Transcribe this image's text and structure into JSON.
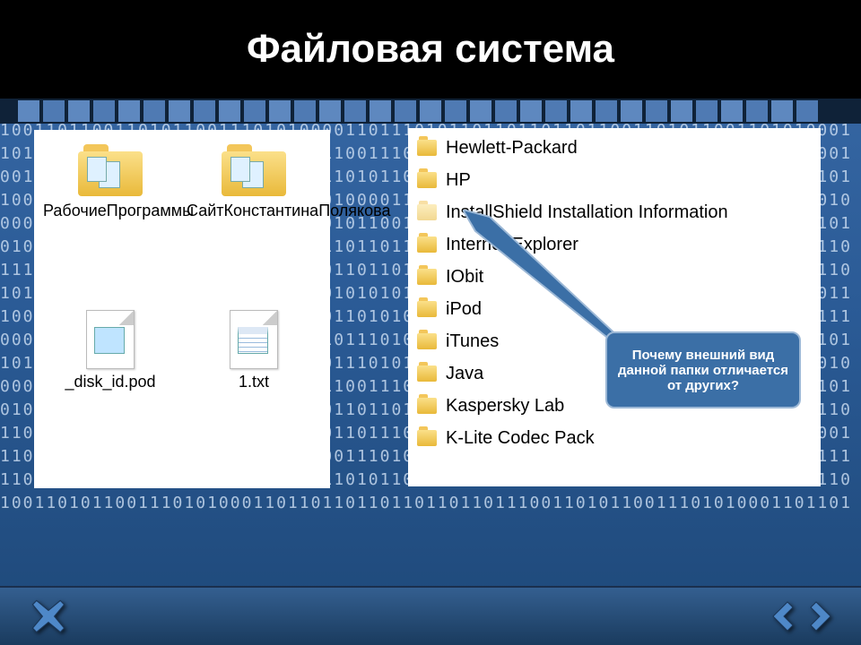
{
  "title": "Файловая система",
  "binary_lines": "10011011001101011001110101000011011101011011011011011001101011001101010001\n10110110110110110111100110101100111010100001110110110110110111001101011001\n00110110110010110110110110111101011011101001101001110110110110110101110101\n10001101010001110110110110110100001110101010101010101010101010101010101010\n00001001101100110101100111010101100111010100001110110110110110101110101101\n01010111011011011011011011101101101101101010001110110110110110101110101110\n11101010101010101010101010110110110110110110110110110110110110110100101110\n10111010001011101010101001110101010101010101001110101010101010101110010011\n10001101010001110110110111100110101010101010101010101101101101101010011111\n00001001101100110101100101011011101001101001110110110110110110101110101101\n10110110110110110111100110000111010101010101010101010101010101010101010010\n00001001101100110101100110101100111010100001110110110110110101110101101101\n01000010011011001101011001110110110110110110110110110110110110100101110110\n11011110011010110011101010000110111010110110110110110011010110011010100001\n11011011011011011110011010110011101010000111011011011011011100110101100111\n11010100011101101101101100001101011001110101000011011101011011011010110110\n10011010110011101010001101101101101101101101110011010110011101010001101101",
  "large_icons": {
    "folder1": "РабочиеПрограммы",
    "folder2": "СайтКонстантинаПолякова",
    "file1": "_disk_id.pod",
    "file2": "1.txt"
  },
  "list_items": [
    {
      "label": "Hewlett-Packard"
    },
    {
      "label": "HP"
    },
    {
      "label": "InstallShield Installation Information",
      "semi": true
    },
    {
      "label": "Internet Explorer"
    },
    {
      "label": "IObit"
    },
    {
      "label": "iPod"
    },
    {
      "label": "iTunes"
    },
    {
      "label": "Java"
    },
    {
      "label": "Kaspersky Lab"
    },
    {
      "label": "K-Lite Codec Pack"
    }
  ],
  "callout_text": "Почему внешний вид данной папки отличается от других?",
  "accent_color": "#3b6fa6"
}
